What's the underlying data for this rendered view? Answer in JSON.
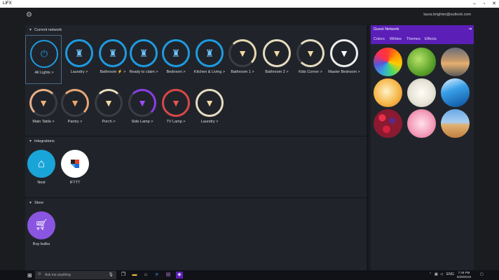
{
  "window": {
    "title": "LIFX"
  },
  "header": {
    "user_email": "laura.brighter@outlook.com"
  },
  "sections": {
    "current_network": "Current network",
    "integrations": "Integrations",
    "store": "Store"
  },
  "lights_row1": [
    {
      "label": "All Lights >"
    },
    {
      "label": "Laundry >"
    },
    {
      "label": "Bathroom ⚡ >"
    },
    {
      "label": "Ready to claim >"
    },
    {
      "label": "Bedroom >"
    },
    {
      "label": "Kitchen & Living >"
    },
    {
      "label": "Bathroom 1 >"
    },
    {
      "label": "Bathroom 2 >"
    },
    {
      "label": "Kids Corner >"
    },
    {
      "label": "Master Bedroom >"
    }
  ],
  "lights_row2": [
    {
      "label": "Main Table >"
    },
    {
      "label": "Pantry >"
    },
    {
      "label": "Porch >"
    },
    {
      "label": "Side Lamp >"
    },
    {
      "label": "TV Lamp >"
    },
    {
      "label": "Laundry >"
    }
  ],
  "integrations": [
    {
      "label": "Nest"
    },
    {
      "label": "IFTTT"
    }
  ],
  "store": [
    {
      "label": "Buy bulbs"
    }
  ],
  "panel": {
    "title": "Guest Network",
    "tabs": [
      "Colors",
      "Whites",
      "Themes",
      "Effects"
    ]
  },
  "taskbar": {
    "search_placeholder": "Ask me anything",
    "language": "ENG",
    "time": "7:49 PM",
    "date": "6/28/2019"
  },
  "colors": {
    "accent_blue": "#1e9be0",
    "panel_purple": "#5b1fb8",
    "nest_teal": "#1aa5d9",
    "store_purple": "#8a55e0"
  }
}
